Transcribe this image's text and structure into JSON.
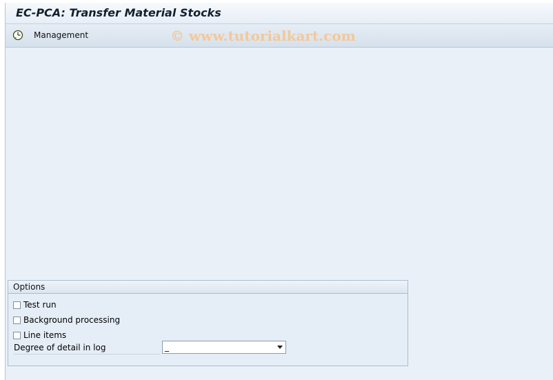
{
  "window": {
    "title": "EC-PCA: Transfer Material Stocks"
  },
  "toolbar": {
    "management_label": "Management",
    "management_icon": "execute-clock-icon"
  },
  "watermark": "© www.tutorialkart.com",
  "options": {
    "header": "Options",
    "test_run": {
      "label": "Test run",
      "checked": false
    },
    "background_processing": {
      "label": "Background processing",
      "checked": false
    },
    "line_items": {
      "label": "Line items",
      "checked": false
    },
    "degree_of_detail": {
      "label": "Degree of detail in log",
      "value": "_"
    }
  },
  "colors": {
    "background": "#e9f0f8",
    "title_text": "#13202e",
    "watermark": "#f2c89a"
  }
}
